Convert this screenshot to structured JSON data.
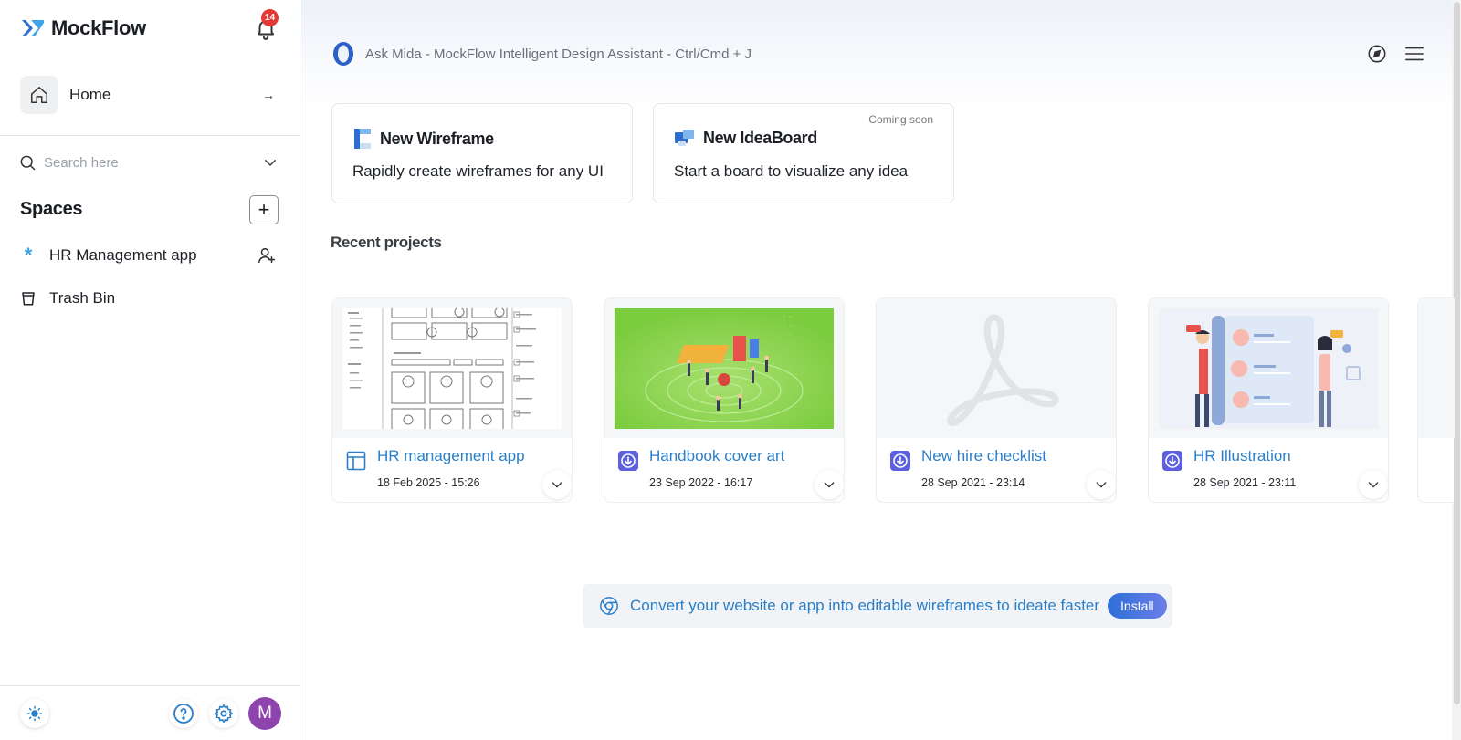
{
  "sidebar": {
    "brand": "MockFlow",
    "notifications_count": "14",
    "home_label": "Home",
    "home_arrow": "→",
    "search_placeholder": "Search here",
    "spaces_title": "Spaces",
    "add_space_label": "+",
    "spaces": [
      {
        "label": "HR Management app",
        "icon": "asterisk-icon"
      },
      {
        "label": "Trash Bin",
        "icon": "trash-icon"
      }
    ],
    "avatar_initial": "M"
  },
  "header": {
    "mida_text": "Ask Mida - MockFlow Intelligent Design Assistant - Ctrl/Cmd + J"
  },
  "new_items": [
    {
      "title": "New Wireframe",
      "desc": "Rapidly create wireframes for any UI",
      "badge": ""
    },
    {
      "title": "New IdeaBoard",
      "desc": "Start a board to visualize any idea",
      "badge": "Coming soon"
    }
  ],
  "recent": {
    "title": "Recent projects",
    "projects": [
      {
        "name": "HR management app",
        "date": "18 Feb 2025 - 15:26",
        "icon": "wireframe-icon"
      },
      {
        "name": "Handbook cover art",
        "date": "23 Sep 2022 - 16:17",
        "icon": "import-icon"
      },
      {
        "name": "New hire checklist",
        "date": "28 Sep 2021 - 23:14",
        "icon": "import-icon"
      },
      {
        "name": "HR Illustration",
        "date": "28 Sep 2021 - 23:11",
        "icon": "import-icon"
      }
    ]
  },
  "banner": {
    "text": "Convert your website or app into editable wireframes to ideate faster",
    "button": "Install"
  },
  "colors": {
    "accent": "#2a7fc8",
    "badge": "#e53935",
    "avatar": "#8e44ad"
  }
}
